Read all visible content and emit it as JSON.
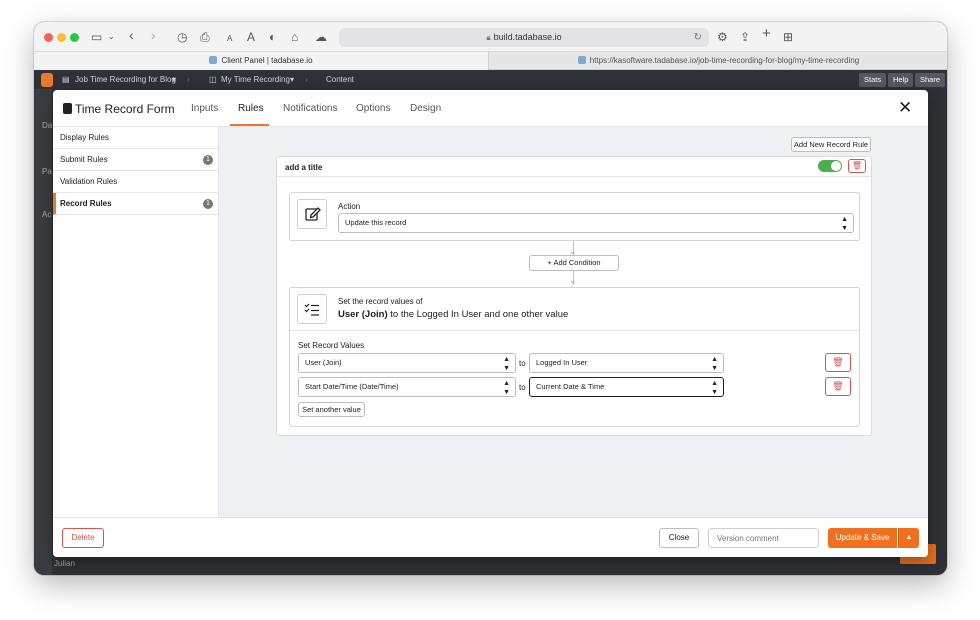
{
  "browser": {
    "url": "build.tadabase.io",
    "tabs": [
      {
        "label": "Client Panel | tadabase.io"
      },
      {
        "label": "https://kasoftware.tadabase.io/job-time-recording-for-blog/my-time-recording"
      }
    ]
  },
  "app_header": {
    "app_name": "Job Time Recording for Blog",
    "page_name": "My Time Recording",
    "section": "Content",
    "buttons": [
      "Stats",
      "Help",
      "Share"
    ]
  },
  "background": {
    "fragments": [
      "Da",
      "Pa",
      "Ac",
      "Julian"
    ]
  },
  "modal": {
    "title": "Time Record Form",
    "tabs": [
      "Inputs",
      "Rules",
      "Notifications",
      "Options",
      "Design"
    ],
    "active_tab": "Rules",
    "sidebar": [
      {
        "label": "Display Rules",
        "count": ""
      },
      {
        "label": "Submit Rules",
        "count": "1"
      },
      {
        "label": "Validation Rules",
        "count": ""
      },
      {
        "label": "Record Rules",
        "count": "1"
      }
    ],
    "add_rule_label": "Add New Record Rule",
    "rule": {
      "title": "add a title",
      "enabled": true,
      "action": {
        "label": "Action",
        "value": "Update this record"
      },
      "add_condition_label": "+ Add Condition",
      "set_values": {
        "heading": "Set the record values of",
        "summary_bold": "User (Join)",
        "summary_rest": " to the Logged In User and one other value",
        "section_label": "Set Record Values",
        "rows": [
          {
            "field": "User (Join)",
            "to": "to",
            "value": "Logged In User"
          },
          {
            "field": "Start Date/Time (Date/Time)",
            "to": "to",
            "value": "Current Date & Time"
          }
        ],
        "add_value_label": "Set another value"
      }
    },
    "footer": {
      "delete_label": "Delete",
      "close_label": "Close",
      "version_placeholder": "Version comment",
      "save_label": "Update & Save"
    }
  }
}
